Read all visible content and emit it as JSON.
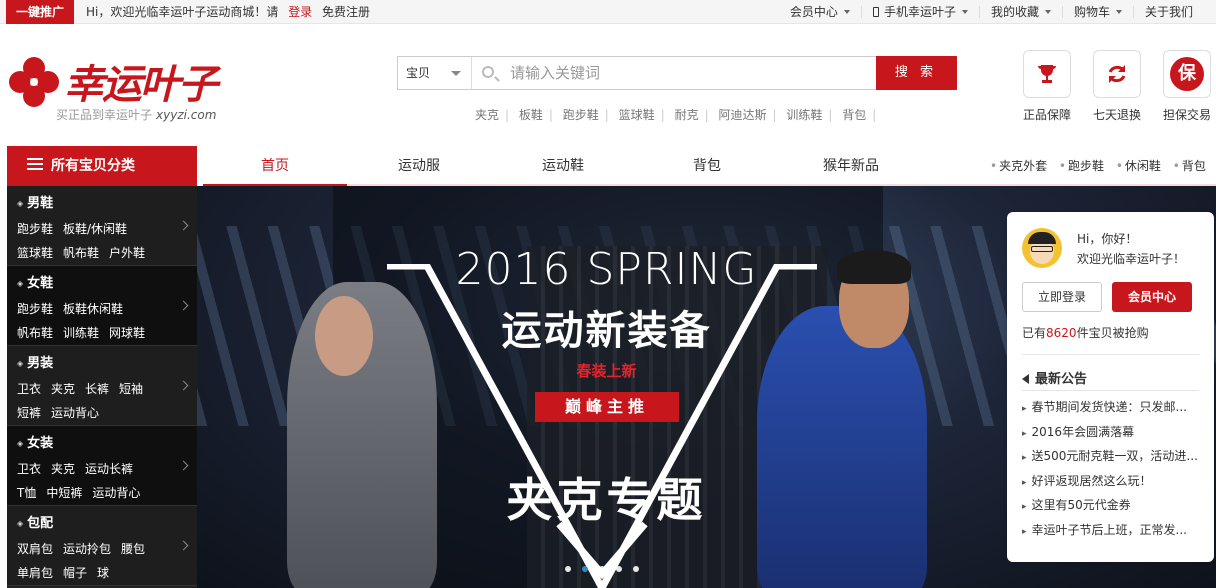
{
  "colors": {
    "brand": "#c8161d",
    "text": "#333333"
  },
  "topbar": {
    "promo": "一键推广",
    "welcome": "Hi，欢迎光临幸运叶子运动商城！请",
    "login": "登录",
    "register": "免费注册",
    "nav": [
      "会员中心",
      "手机幸运叶子",
      "我的收藏",
      "购物车",
      "关于我们"
    ]
  },
  "logo": {
    "text": "幸运叶子",
    "slogan": "买正品到幸运叶子",
    "domain": "xyyzi.com",
    "icon": "four-leaf-clover-icon"
  },
  "search": {
    "category": "宝贝",
    "placeholder": "请输入关键词",
    "button": "搜 索",
    "hotwords": [
      "夹克",
      "板鞋",
      "跑步鞋",
      "篮球鞋",
      "耐克",
      "阿迪达斯",
      "训练鞋",
      "背包"
    ]
  },
  "services": [
    {
      "label": "正品保障",
      "icon": "trophy-icon"
    },
    {
      "label": "七天退换",
      "icon": "refresh-icon"
    },
    {
      "label": "担保交易",
      "icon": "guarantee-icon",
      "glyph": "保"
    }
  ],
  "nav": {
    "all_categories": "所有宝贝分类",
    "items": [
      "首页",
      "运动服",
      "运动鞋",
      "背包",
      "猴年新品"
    ],
    "active": "首页",
    "quick_links": [
      "夹克外套",
      "跑步鞋",
      "休闲鞋",
      "背包"
    ]
  },
  "categories": [
    {
      "title": "男鞋",
      "rows": [
        [
          "跑步鞋",
          "板鞋/休闲鞋"
        ],
        [
          "篮球鞋",
          "帆布鞋",
          "户外鞋"
        ]
      ]
    },
    {
      "title": "女鞋",
      "rows": [
        [
          "跑步鞋",
          "板鞋休闲鞋"
        ],
        [
          "帆布鞋",
          "训练鞋",
          "网球鞋"
        ]
      ]
    },
    {
      "title": "男装",
      "rows": [
        [
          "卫衣",
          "夹克",
          "长裤",
          "短袖"
        ],
        [
          "短裤",
          "运动背心"
        ]
      ]
    },
    {
      "title": "女装",
      "rows": [
        [
          "卫衣",
          "夹克",
          "运动长裤"
        ],
        [
          "T恤",
          "中短裤",
          "运动背心"
        ]
      ]
    },
    {
      "title": "包配",
      "rows": [
        [
          "双肩包",
          "运动拎包",
          "腰包"
        ],
        [
          "单肩包",
          "帽子",
          "球"
        ]
      ]
    }
  ],
  "banner": {
    "headline": "2016 SPRING",
    "title": "运动新装备",
    "subtitle": "春装上新",
    "badge": "巅峰主推",
    "topic": "夹克专题",
    "slide_count": 5,
    "active_slide": 2
  },
  "user_card": {
    "greeting": "Hi，你好！",
    "welcome": "欢迎光临幸运叶子！",
    "login_button": "立即登录",
    "member_button": "会员中心",
    "stat_prefix": "已有",
    "stat_count": "8620",
    "stat_suffix": "件宝贝被抢购",
    "news_title": "最新公告",
    "news": [
      "春节期间发货快递：只发邮...",
      "2016年会圆满落幕",
      "送500元耐克鞋一双，活动进...",
      "好评返现居然这么玩！",
      "这里有50元代金券",
      "幸运叶子节后上班，正常发..."
    ]
  }
}
